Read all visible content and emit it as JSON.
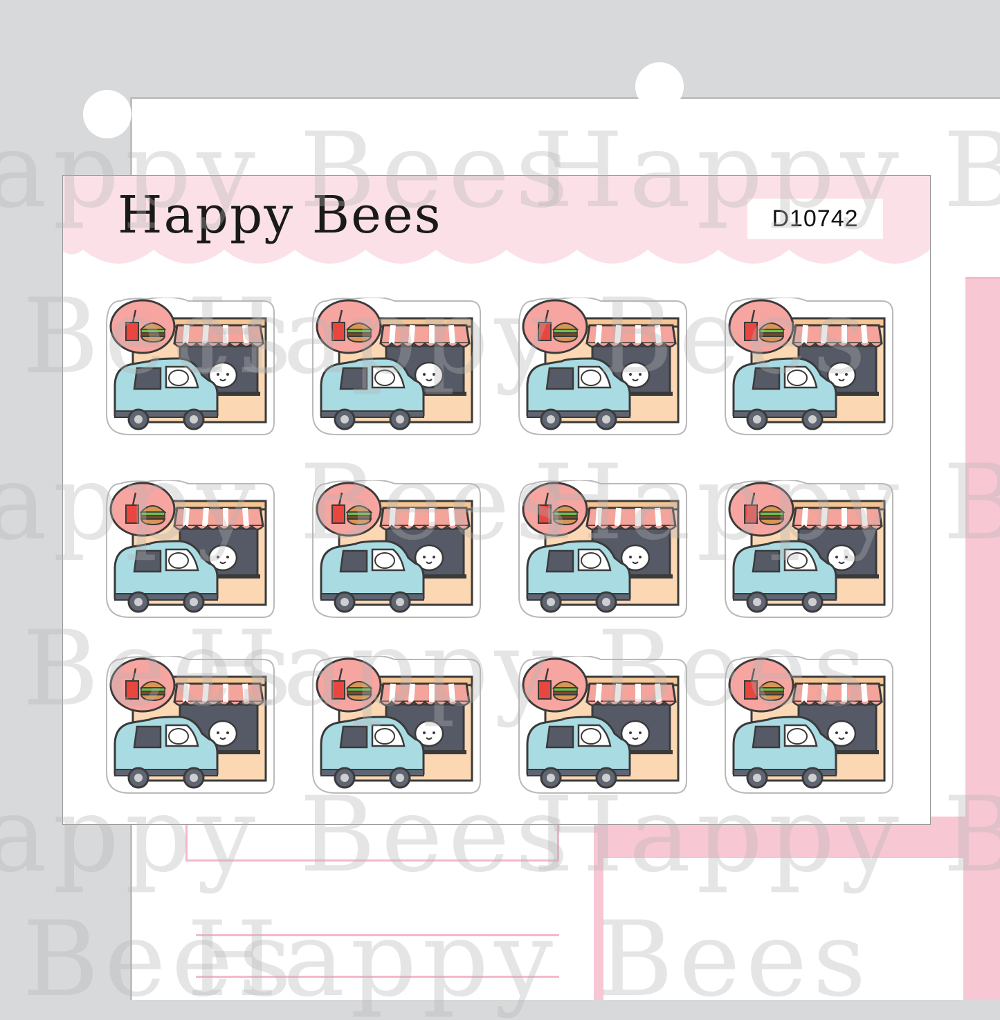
{
  "brand": "Happy Bees",
  "product_code": "D10742",
  "watermark_text": "Happy Bees",
  "sticker_grid": {
    "rows": 3,
    "cols": 4,
    "motif": "drive-thru-sticker"
  },
  "colors": {
    "banner_pink": "#fbe1e7",
    "planner_pink": "#f7c7d4",
    "car_blue": "#a9dbe3",
    "awning_pink": "#f4a49a",
    "building_peach": "#fbd8b3",
    "food_bubble": "#f6a5a0",
    "outline": "#3a3a3a"
  }
}
